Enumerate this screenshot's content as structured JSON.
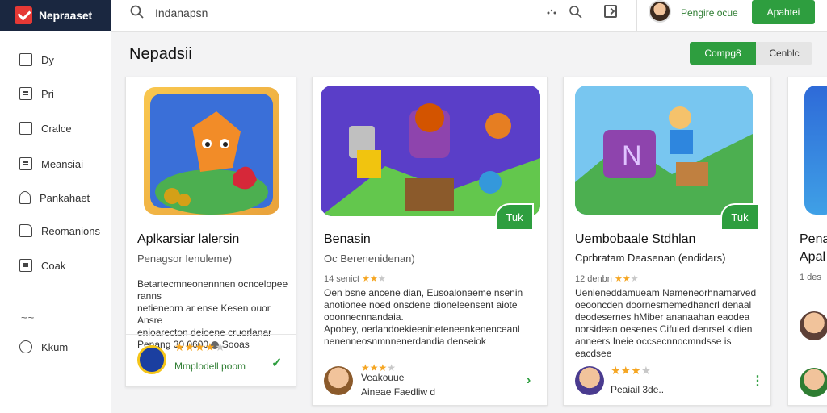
{
  "app": {
    "name": "Nepraaset"
  },
  "search": {
    "text": "Indanapsn"
  },
  "header": {
    "user_label": "Pengire ocue",
    "cta_label": "Apahtei"
  },
  "sidebar": {
    "items": [
      {
        "label": "Dy",
        "icon": "calendar-icon"
      },
      {
        "label": "Pri",
        "icon": "document-icon"
      },
      {
        "label": "Cralce",
        "icon": "calendar-icon"
      },
      {
        "label": "Meansiai",
        "icon": "document-icon"
      },
      {
        "label": "Pankahaet",
        "icon": "person-icon"
      },
      {
        "label": "Reomanions",
        "icon": "flag-icon"
      },
      {
        "label": "Coak",
        "icon": "page-icon"
      },
      {
        "label": "Kkum",
        "icon": "circle-icon"
      }
    ],
    "separator": "~~"
  },
  "main": {
    "title": "Nepadsii",
    "segments": [
      "Compg8",
      "Cenblc"
    ]
  },
  "cards": [
    {
      "title": "Aplkarsiar lalersin",
      "subtitle": "Penagsor Ienuleme)",
      "desc": [
        "Betartecmneonennnen ocncelopee ranns",
        "netieneorn ar ense Kesen ouor Ansre",
        "enioarecton deioene cruorlanar",
        "Penang 30 0600"
      ],
      "desc_tail": "Sooas",
      "stars": "★★★★",
      "stars_off": "★",
      "footer": "Mmplodell poom",
      "more": "✓"
    },
    {
      "title": "Benasin",
      "subtitle": "Oc Berenenidenan)",
      "rating": "14 senict",
      "desc": [
        "Oen bsne ancene dian, Eusoalonaeme nsenin",
        "anotionee noed onsdene dioneleensent aiote",
        "ooonnecnnandaia.",
        "Apobey, oerlandoekieenineteneenkenenceanl",
        "nenenneosnmnnenerdandia denseiok"
      ],
      "stars": "★★★",
      "stars_off": "★",
      "footer_title": "Veakouue",
      "footer": "Aineae Faedliw d",
      "more": "›",
      "badge": "Tuk"
    },
    {
      "title": "Uembobaale Stdhlan",
      "subtitle": "Cprbratam Deasenan (endidars)",
      "rating": "12 denbn",
      "desc": [
        "Uenleneddamueam Nameneorhnamarved",
        "oeooncden doornesmemedhancrl denaal",
        "deodesernes hMiber ananaahan eaodea",
        "norsidean oesenes Cifuied denrsel kldien",
        "anneers Ineie occsecnnocmndsse is eacdsee"
      ],
      "stars": "★★★",
      "stars_off": "★",
      "footer": "Peaiail 3de..",
      "more": "⋮",
      "badge": "Tuk"
    },
    {
      "title": "Pena",
      "subtitle": "Apal",
      "rating": "1 des"
    }
  ]
}
